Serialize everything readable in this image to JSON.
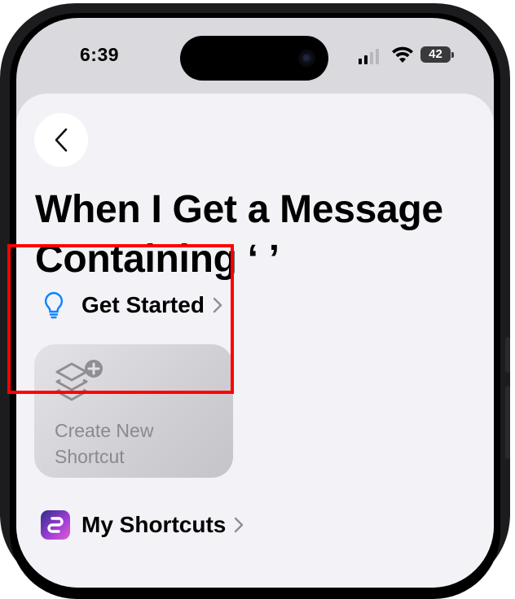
{
  "status_bar": {
    "time": "6:39",
    "battery_level": "42"
  },
  "nav": {
    "back_icon": "chevron-left-icon"
  },
  "page": {
    "title_line1": "When I Get a Message",
    "title_line2": "Containing ‘ ’"
  },
  "get_started": {
    "icon": "lightbulb-icon",
    "label": "Get Started"
  },
  "create_card": {
    "icon": "shortcut-add-icon",
    "label_line1": "Create New",
    "label_line2": "Shortcut"
  },
  "my_shortcuts": {
    "icon": "shortcuts-app-icon",
    "label": "My Shortcuts"
  },
  "colors": {
    "accent_blue": "#0a84ff",
    "highlight_red": "#ff0000",
    "sheet_background": "#f2f2f7"
  }
}
